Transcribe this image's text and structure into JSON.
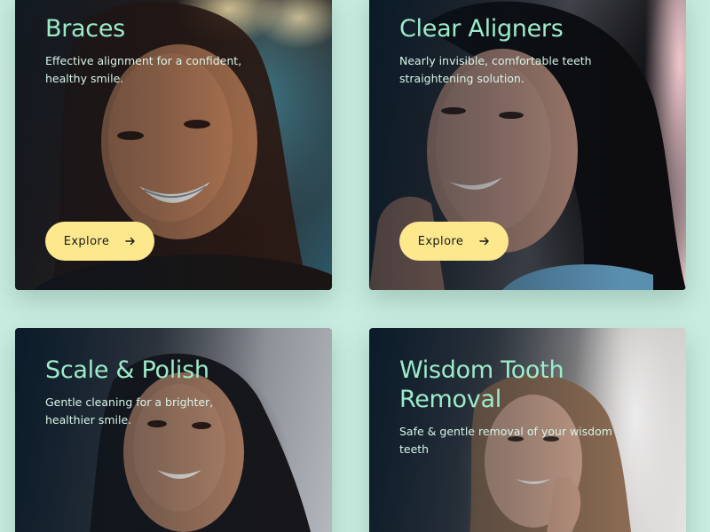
{
  "cards": [
    {
      "title": "Braces",
      "description": "Effective alignment for a confident, healthy smile.",
      "button": {
        "label": "Explore",
        "icon": "arrow-right-icon"
      }
    },
    {
      "title": "Clear Aligners",
      "description": "Nearly invisible, comfortable teeth straightening solution.",
      "button": {
        "label": "Explore",
        "icon": "arrow-right-icon"
      }
    },
    {
      "title": "Scale & Polish",
      "description": "Gentle cleaning for a brighter, healthier smile."
    },
    {
      "title": "Wisdom Tooth Removal",
      "description": "Safe & gentle removal of your wisdom teeth"
    }
  ],
  "colors": {
    "page_background": "#c8ede0",
    "title_text": "#9cebc9",
    "button_background": "#fde88e",
    "button_text": "#1a1a1a"
  }
}
